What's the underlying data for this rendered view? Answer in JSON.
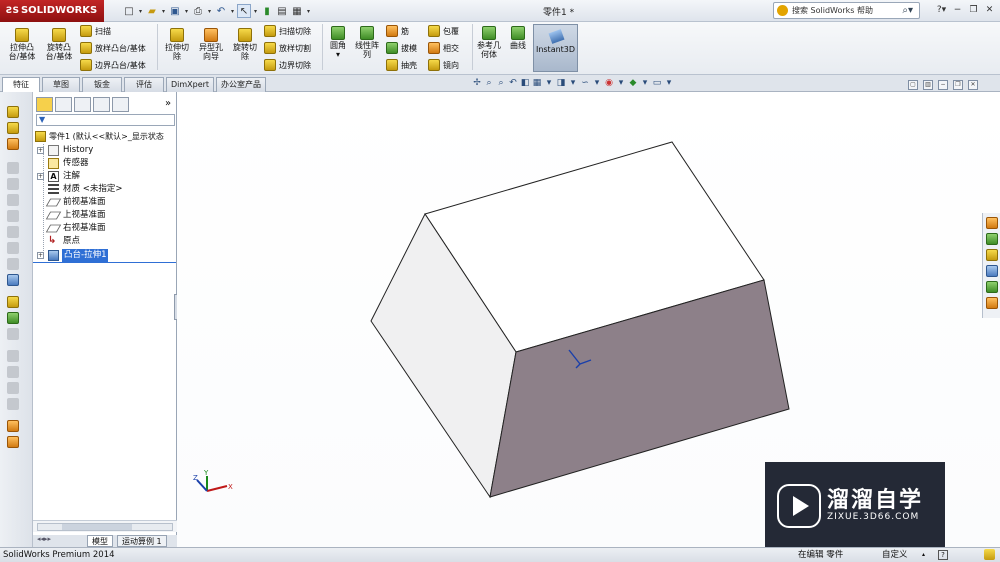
{
  "app": {
    "product": "SOLIDWORKS",
    "document_title": "零件1 *"
  },
  "search": {
    "placeholder": "搜索 SolidWorks 帮助"
  },
  "ribbon": {
    "extrude_boss": "拉伸凸\n台/基体",
    "revolve_boss": "旋转凸\n台/基体",
    "sweep": "扫描",
    "loft_boss": "放样凸台/基体",
    "boundary_boss": "边界凸台/基体",
    "extrude_cut": "拉伸切\n除",
    "hole_wizard": "异型孔\n向导",
    "revolve_cut": "旋转切\n除",
    "swept_cut": "扫描切除",
    "lofted_cut": "放样切割",
    "boundary_cut": "边界切除",
    "fillet": "圆角",
    "linear_pattern": "线性阵\n列",
    "rib": "筋",
    "draft": "拔模",
    "shell": "抽壳",
    "wrap": "包覆",
    "intersect": "相交",
    "mirror": "镜向",
    "ref_geometry": "参考几\n何体",
    "curves": "曲线",
    "instant3d": "Instant3D"
  },
  "tabs": [
    {
      "label": "特征",
      "active": true
    },
    {
      "label": "草图",
      "active": false
    },
    {
      "label": "钣金",
      "active": false
    },
    {
      "label": "评估",
      "active": false
    },
    {
      "label": "DimXpert",
      "active": false
    },
    {
      "label": "办公室产品",
      "active": false
    }
  ],
  "tree": {
    "root": "零件1 (默认<<默认>_显示状态",
    "items": [
      {
        "label": "History",
        "icon": "history-icon",
        "selected": false
      },
      {
        "label": "传感器",
        "icon": "sensor-icon",
        "selected": false
      },
      {
        "label": "注解",
        "icon": "annotation-icon",
        "selected": false
      },
      {
        "label": "材质 <未指定>",
        "icon": "material-icon",
        "selected": false
      },
      {
        "label": "前视基准面",
        "icon": "plane-icon",
        "selected": false
      },
      {
        "label": "上视基准面",
        "icon": "plane-icon",
        "selected": false
      },
      {
        "label": "右视基准面",
        "icon": "plane-icon",
        "selected": false
      },
      {
        "label": "原点",
        "icon": "origin-icon",
        "selected": false
      },
      {
        "label": "凸台-拉伸1",
        "icon": "extrude-icon",
        "selected": true
      }
    ]
  },
  "bottom_tabs": [
    {
      "label": "模型",
      "active": true
    },
    {
      "label": "运动算例 1",
      "active": false
    }
  ],
  "watermark": {
    "title": "溜溜自学",
    "subtitle": "ZIXUE.3D66.COM"
  },
  "status": {
    "left": "SolidWorks Premium 2014",
    "editing": "在编辑 零件",
    "units": "自定义",
    "help": "?"
  },
  "colors": {
    "accent": "#2f6fd5",
    "model_top": "#ffffff",
    "model_side": "#f0f0f1",
    "model_front": "#8d8089",
    "watermark_bg": "#161c29"
  }
}
